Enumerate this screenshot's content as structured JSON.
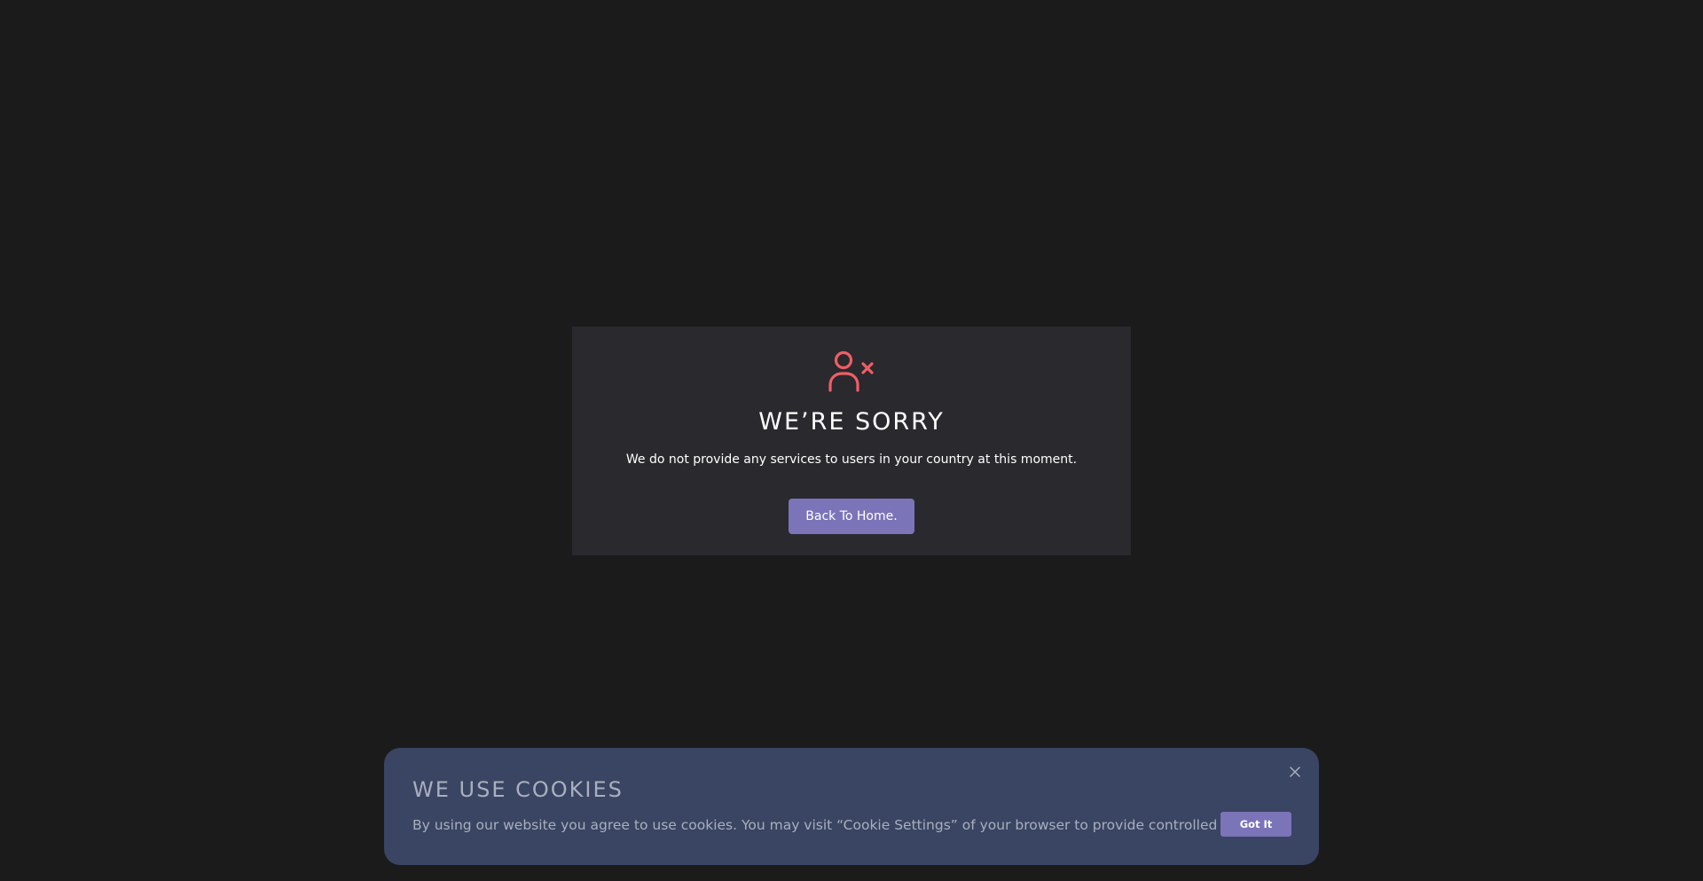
{
  "notice": {
    "icon": "user-x-icon",
    "title": "WE’RE SORRY",
    "message": "We do not provide any services to users in your country at this moment.",
    "button_label": "Back To Home.",
    "accent_color": "#ef5e66",
    "button_color": "#7b74b9"
  },
  "cookie_banner": {
    "title": "WE USE COOKIES",
    "message": "By using our website you agree to use cookies. You may visit “Cookie Settings” of your browser to provide controlled consent.",
    "accept_label": "Got It",
    "close_icon": "close-icon",
    "background_color": "#394562"
  }
}
